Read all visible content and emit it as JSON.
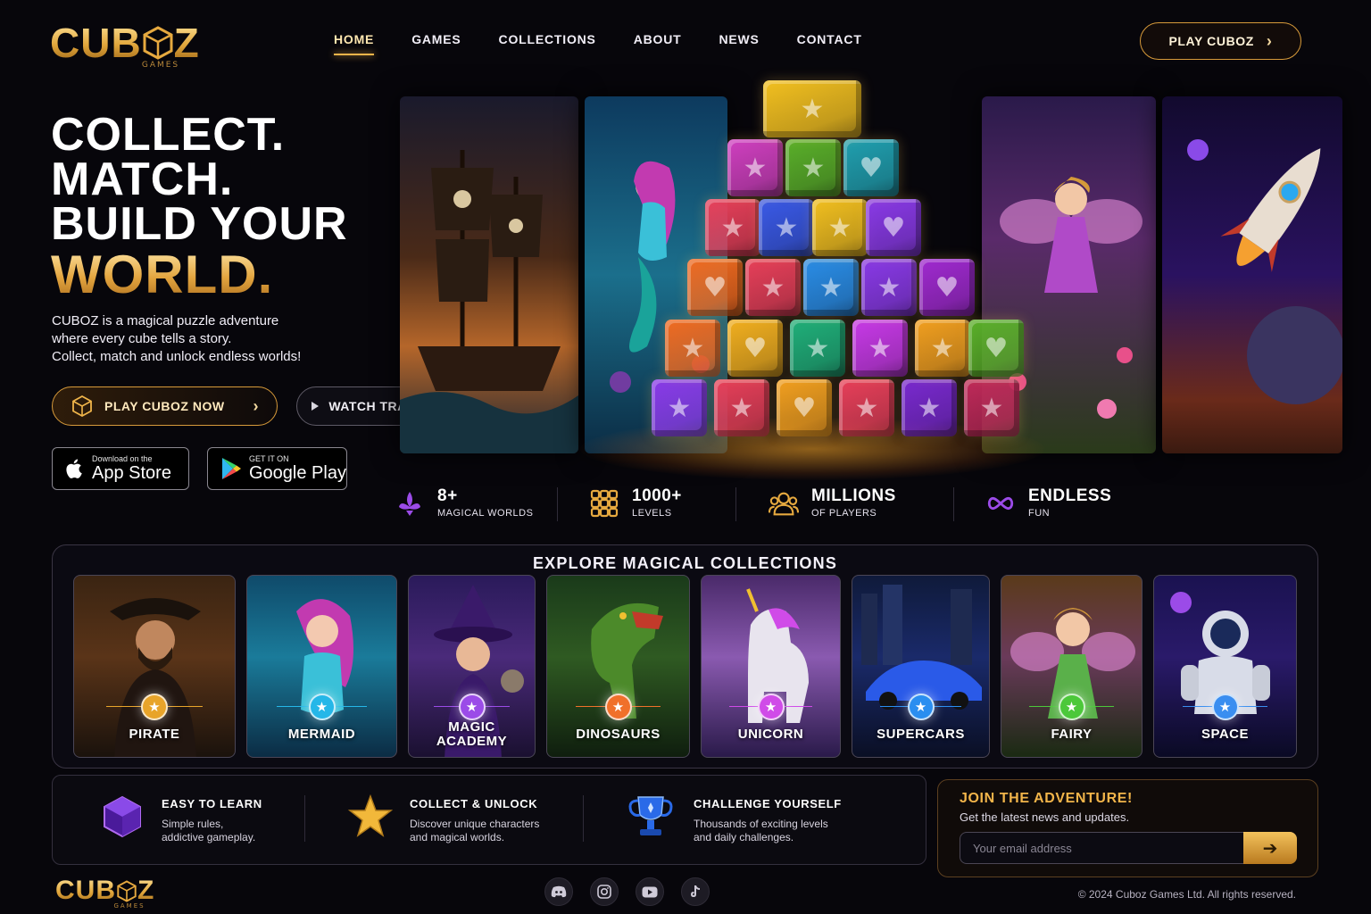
{
  "brand": {
    "name_left": "CUB",
    "name_right": "Z",
    "sub": "GAMES"
  },
  "nav": {
    "items": [
      {
        "label": "HOME",
        "active": true
      },
      {
        "label": "GAMES"
      },
      {
        "label": "COLLECTIONS"
      },
      {
        "label": "ABOUT"
      },
      {
        "label": "NEWS"
      },
      {
        "label": "CONTACT"
      }
    ],
    "cta": "PLAY CUBOZ"
  },
  "hero": {
    "line1": "COLLECT.",
    "line2": "MATCH.",
    "line3": "BUILD YOUR",
    "line4": "WORLD.",
    "desc1": "CUBOZ is a magical puzzle adventure",
    "desc2": "where every cube tells a story.",
    "desc3": "Collect, match and unlock endless worlds!",
    "primary_button": "PLAY CUBOZ NOW",
    "secondary_button": "WATCH TRAILER"
  },
  "stores": {
    "apple_small": "Download on the",
    "apple_big": "App Store",
    "google_small": "GET IT ON",
    "google_big": "Google Play"
  },
  "stats": [
    {
      "value": "8+",
      "label": "MAGICAL WORLDS"
    },
    {
      "value": "1000+",
      "label": "LEVELS"
    },
    {
      "value": "MILLIONS",
      "label": "OF PLAYERS"
    },
    {
      "value": "ENDLESS",
      "label": "FUN"
    }
  ],
  "collections": {
    "title": "EXPLORE MAGICAL COLLECTIONS",
    "items": [
      {
        "label": "PIRATE",
        "accent": "#e8a42a"
      },
      {
        "label": "MERMAID",
        "accent": "#25b7e8"
      },
      {
        "label": "MAGIC",
        "label2": "ACADEMY",
        "accent": "#9b4be8"
      },
      {
        "label": "DINOSAURS",
        "accent": "#f0702a"
      },
      {
        "label": "UNICORN",
        "accent": "#d04be8"
      },
      {
        "label": "SUPERCARS",
        "accent": "#2a8ef0"
      },
      {
        "label": "FAIRY",
        "accent": "#4cc83a"
      },
      {
        "label": "SPACE",
        "accent": "#3a8ef0"
      }
    ]
  },
  "features": [
    {
      "title": "EASY TO LEARN",
      "desc1": "Simple rules,",
      "desc2": "addictive gameplay."
    },
    {
      "title": "COLLECT & UNLOCK",
      "desc1": "Discover unique characters",
      "desc2": "and magical worlds."
    },
    {
      "title": "CHALLENGE YOURSELF",
      "desc1": "Thousands of exciting levels",
      "desc2": "and daily challenges."
    }
  ],
  "newsletter": {
    "title": "JOIN THE ADVENTURE!",
    "subtitle": "Get the latest news and updates.",
    "placeholder": "Your email address"
  },
  "footer": {
    "socials": [
      "discord-icon",
      "instagram-icon",
      "youtube-icon",
      "tiktok-icon"
    ],
    "copyright": "© 2024 Cuboz Games Ltd. All rights reserved."
  }
}
